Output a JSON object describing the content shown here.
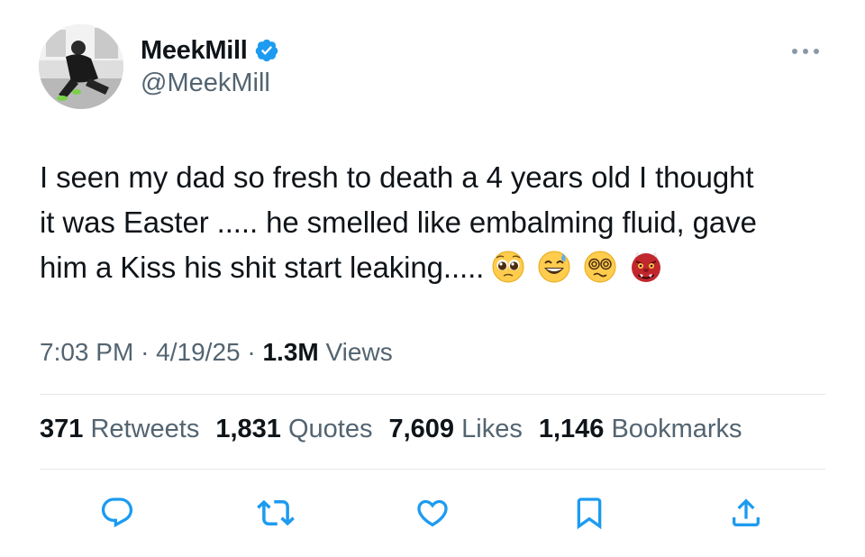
{
  "author": {
    "display_name": "MeekMill",
    "handle": "@MeekMill",
    "verified": true,
    "verified_color": "#1d9bf0"
  },
  "tweet": {
    "lines": [
      "I seen my dad so fresh to death a 4 years old I thought",
      "it was Easter ..... he smelled like embalming fluid,  gave",
      "him a Kiss his shit start leaking....."
    ],
    "emojis": [
      "pleading-face",
      "grinning-face-with-sweat",
      "face-with-spiral-eyes",
      "ogre"
    ]
  },
  "meta": {
    "time": "7:03 PM",
    "date": "4/19/25",
    "views_count": "1.3M",
    "views_label": "Views",
    "separator": "·"
  },
  "stats": {
    "retweets": {
      "count": "371",
      "label": "Retweets"
    },
    "quotes": {
      "count": "1,831",
      "label": "Quotes"
    },
    "likes": {
      "count": "7,609",
      "label": "Likes"
    },
    "bookmarks": {
      "count": "1,146",
      "label": "Bookmarks"
    }
  },
  "actions": [
    "reply-icon",
    "retweet-icon",
    "like-icon",
    "bookmark-icon",
    "share-icon"
  ],
  "colors": {
    "text": "#0f1419",
    "secondary": "#536471",
    "divider": "#e4e7ea",
    "icon": "#1d9bf0"
  }
}
